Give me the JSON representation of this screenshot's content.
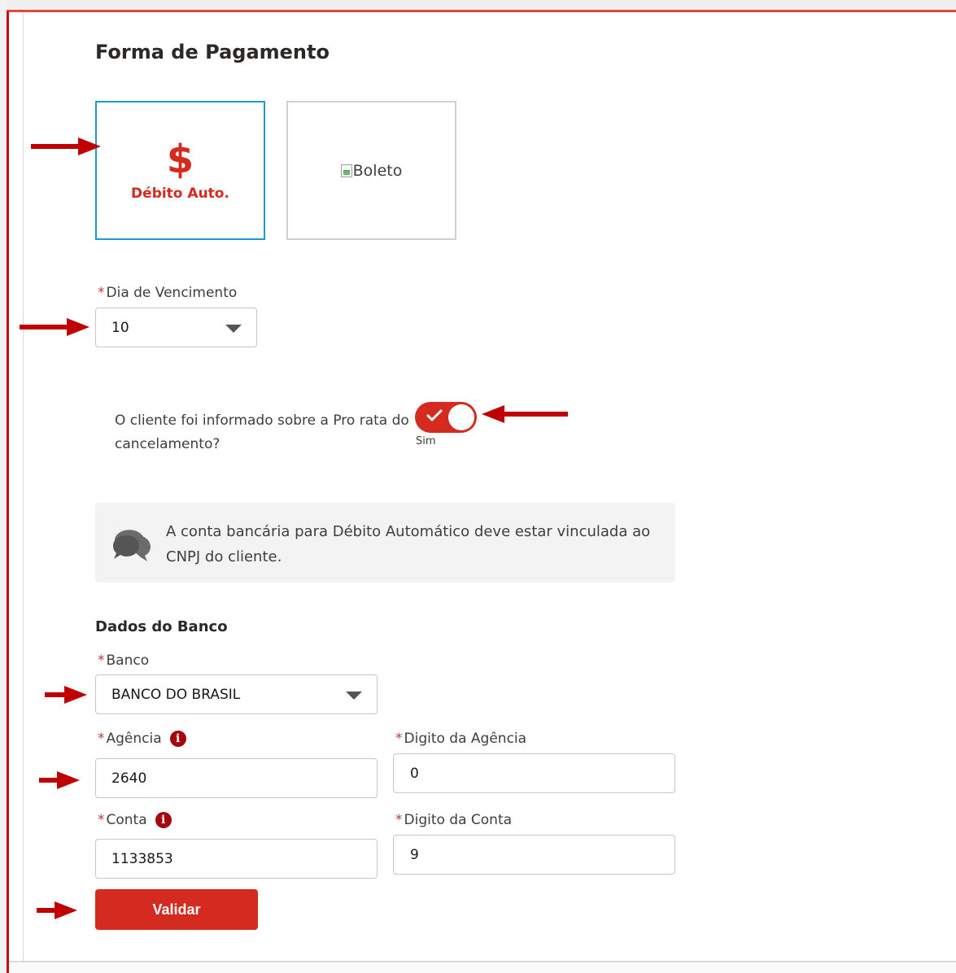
{
  "colors": {
    "accent_red": "#d42a1f",
    "selected_border": "#1b9ad6",
    "annotation_arrow": "#c00000"
  },
  "section": {
    "title": "Forma de Pagamento"
  },
  "payment_methods": [
    {
      "label": "Débito Auto.",
      "icon": "dollar-icon",
      "selected": true
    },
    {
      "label": "Boleto",
      "icon": "broken-image-icon",
      "selected": false
    }
  ],
  "due_day": {
    "label": "Dia de Vencimento",
    "required": "*",
    "value": "10"
  },
  "pro_rata": {
    "question": "O cliente foi informado sobre a Pro rata do cancelamento?",
    "toggle_on": true,
    "toggle_caption": "Sim"
  },
  "notice": {
    "icon": "chat-bubbles-icon",
    "text": "A conta bancária para Débito Automático deve estar vinculada ao CNPJ do cliente."
  },
  "bank": {
    "title": "Dados do Banco",
    "banco": {
      "label": "Banco",
      "value": "BANCO DO BRASIL"
    },
    "agencia": {
      "label": "Agência",
      "value": "2640",
      "info_icon": "i"
    },
    "digito_agencia": {
      "label": "Digito da Agência",
      "value": "0"
    },
    "conta": {
      "label": "Conta",
      "value": "1133853",
      "info_icon": "i"
    },
    "digito_conta": {
      "label": "Digito da Conta",
      "value": "9"
    },
    "required_mark": "*"
  },
  "actions": {
    "validar": "Validar"
  }
}
